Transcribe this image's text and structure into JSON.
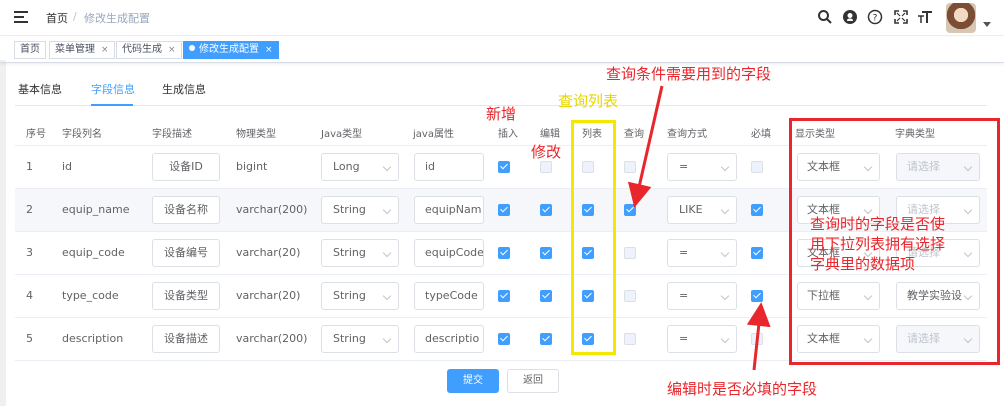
{
  "breadcrumb": {
    "home": "首页",
    "sep": "/",
    "current": "修改生成配置"
  },
  "header_icons": [
    "search-icon",
    "github-icon",
    "question-icon",
    "fullscreen-icon",
    "font-size-icon"
  ],
  "tags": [
    {
      "label": "首页",
      "closable": false,
      "active": false
    },
    {
      "label": "菜单管理",
      "closable": true,
      "active": false
    },
    {
      "label": "代码生成",
      "closable": true,
      "active": false
    },
    {
      "label": "修改生成配置",
      "closable": true,
      "active": true
    }
  ],
  "tag_close": "×",
  "tabs": [
    "基本信息",
    "字段信息",
    "生成信息"
  ],
  "columns": [
    "序号",
    "字段列名",
    "字段描述",
    "物理类型",
    "Java类型",
    "java属性",
    "插入",
    "编辑",
    "列表",
    "查询",
    "查询方式",
    "必填",
    "显示类型",
    "字典类型"
  ],
  "rows": [
    {
      "no": "1",
      "column": "id",
      "desc": "设备ID",
      "phys": "bigint",
      "java_type": "Long",
      "java_field": "id",
      "insert": true,
      "edit": false,
      "edit_disabled": true,
      "list": false,
      "list_disabled": true,
      "query": false,
      "query_disabled": true,
      "query_type": "=",
      "required": false,
      "required_disabled": true,
      "html_type": "文本框",
      "dict": "请选择",
      "dict_disabled": true
    },
    {
      "no": "2",
      "column": "equip_name",
      "desc": "设备名称",
      "phys": "varchar(200)",
      "java_type": "String",
      "java_field": "equipNam",
      "insert": true,
      "edit": true,
      "edit_disabled": false,
      "list": true,
      "list_disabled": false,
      "query": true,
      "query_disabled": false,
      "query_type": "LIKE",
      "required": true,
      "required_disabled": false,
      "html_type": "文本框",
      "dict": "请选择",
      "dict_disabled": false
    },
    {
      "no": "3",
      "column": "equip_code",
      "desc": "设备编号",
      "phys": "varchar(20)",
      "java_type": "String",
      "java_field": "equipCode",
      "insert": true,
      "edit": true,
      "edit_disabled": false,
      "list": true,
      "list_disabled": false,
      "query": false,
      "query_disabled": true,
      "query_type": "=",
      "required": true,
      "required_disabled": false,
      "html_type": "文本框",
      "dict": "请选择",
      "dict_disabled": false
    },
    {
      "no": "4",
      "column": "type_code",
      "desc": "设备类型",
      "phys": "varchar(20)",
      "java_type": "String",
      "java_field": "typeCode",
      "insert": true,
      "edit": true,
      "edit_disabled": false,
      "list": true,
      "list_disabled": false,
      "query": false,
      "query_disabled": true,
      "query_type": "=",
      "required": true,
      "required_disabled": false,
      "html_type": "下拉框",
      "dict": "教学实验设",
      "dict_disabled": false
    },
    {
      "no": "5",
      "column": "description",
      "desc": "设备描述",
      "phys": "varchar(200)",
      "java_type": "String",
      "java_field": "descriptio",
      "insert": true,
      "edit": true,
      "edit_disabled": false,
      "list": true,
      "list_disabled": false,
      "query": false,
      "query_disabled": true,
      "query_type": "=",
      "required": false,
      "required_disabled": true,
      "html_type": "文本框",
      "dict": "请选择",
      "dict_disabled": true
    }
  ],
  "buttons": {
    "submit": "提交",
    "back": "返回"
  },
  "annotations": {
    "query_field": "查询条件需要用到的字段",
    "list_query": "查询列表",
    "add": "新增",
    "modify": "修改",
    "dict_line1": "查询时的字段是否使",
    "dict_line2": "用下拉列表拥有选择",
    "dict_line3": "字典里的数据项",
    "required_field": "编辑时是否必填的字段"
  },
  "colors": {
    "primary": "#409eff",
    "annotation_red": "#e8262b",
    "annotation_yellow": "#f5e800"
  }
}
